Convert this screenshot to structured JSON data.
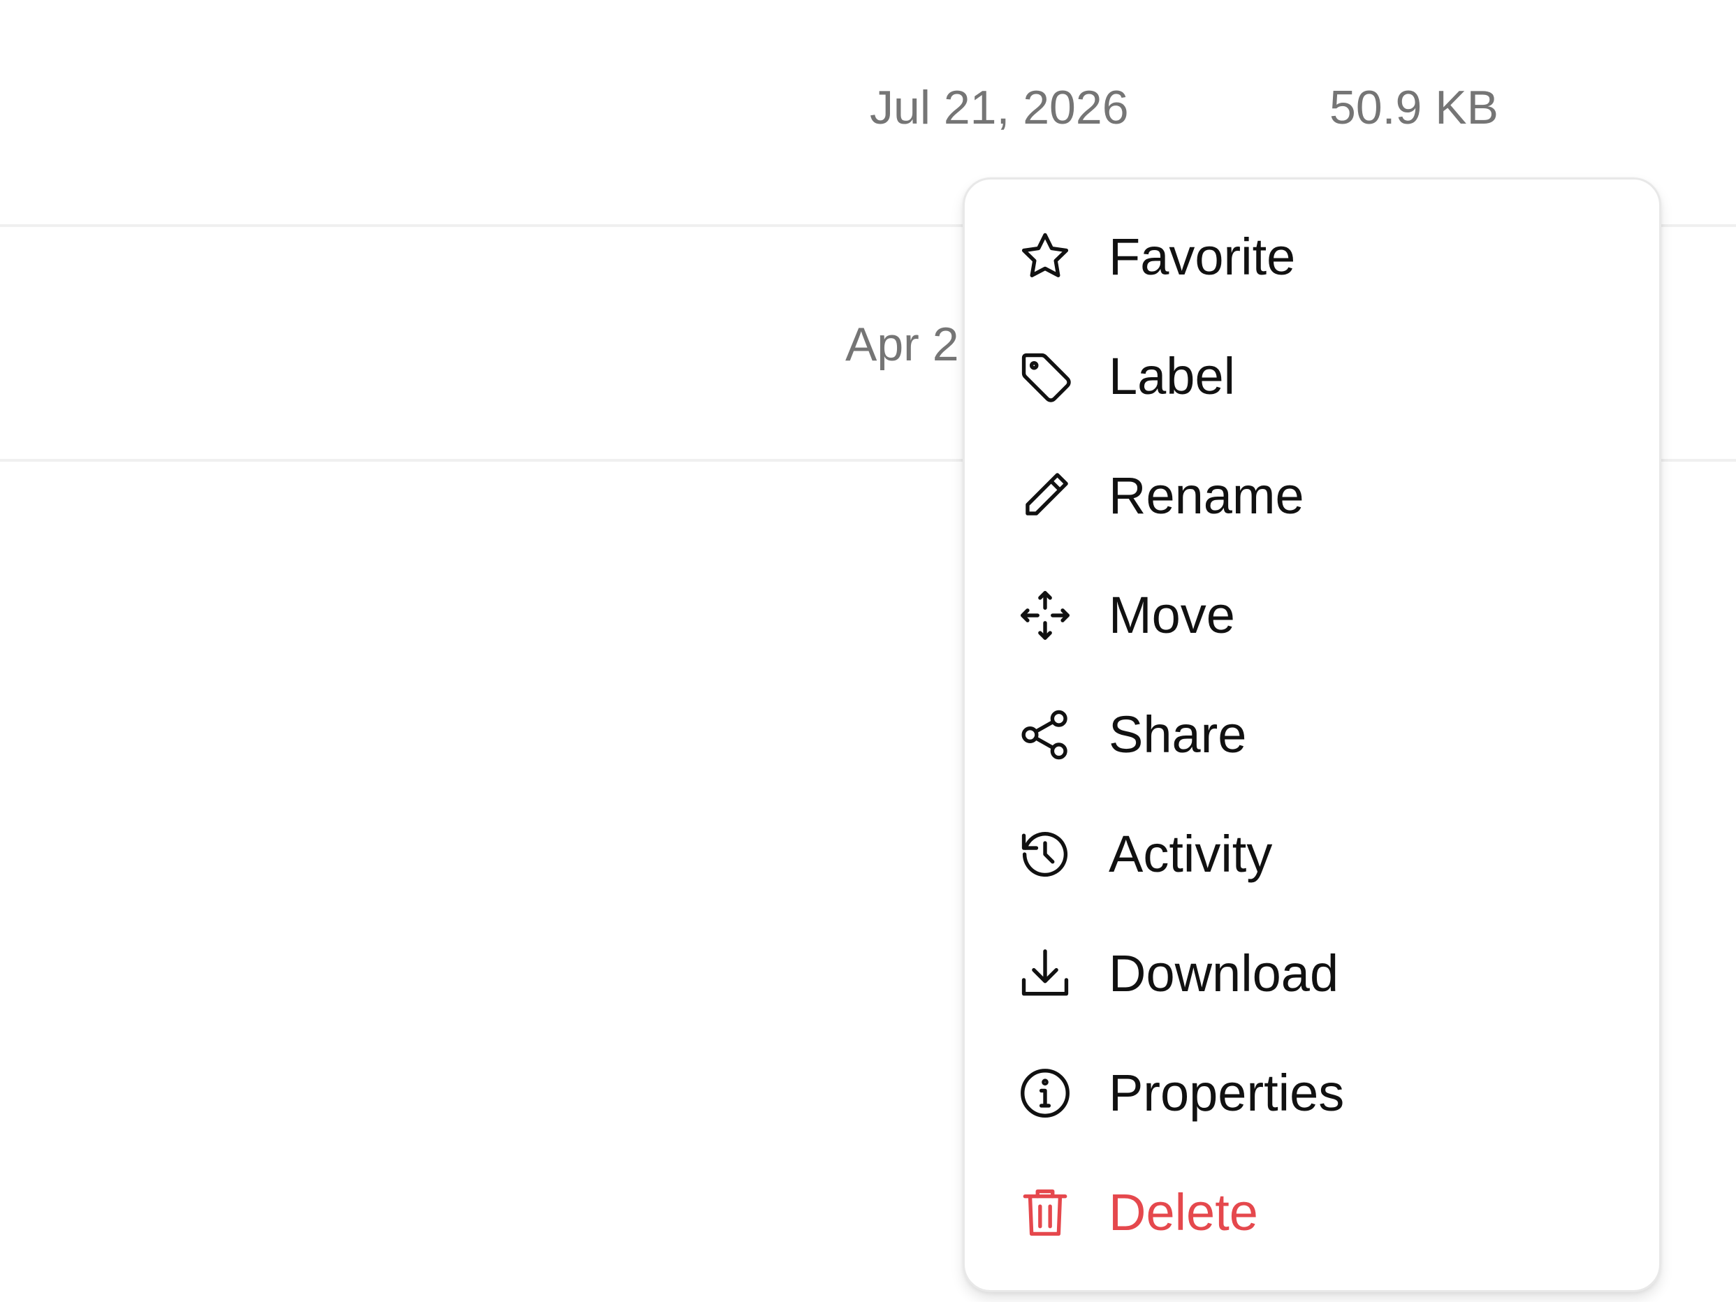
{
  "file_list": {
    "rows": [
      {
        "modified": "Jul 21, 2026",
        "size": "50.9 KB"
      },
      {
        "modified": "Apr 2",
        "size": ""
      }
    ]
  },
  "context_menu": {
    "items": [
      {
        "label": "Favorite",
        "icon": "star-icon"
      },
      {
        "label": "Label",
        "icon": "tag-icon"
      },
      {
        "label": "Rename",
        "icon": "pencil-icon"
      },
      {
        "label": "Move",
        "icon": "move-arrows-icon"
      },
      {
        "label": "Share",
        "icon": "share-icon"
      },
      {
        "label": "Activity",
        "icon": "history-icon"
      },
      {
        "label": "Download",
        "icon": "download-icon"
      },
      {
        "label": "Properties",
        "icon": "info-icon"
      },
      {
        "label": "Delete",
        "icon": "trash-icon"
      }
    ],
    "colors": {
      "text": "#111111",
      "danger": "#e5484d",
      "muted_text": "#757575",
      "border": "#e8e8e8"
    }
  }
}
